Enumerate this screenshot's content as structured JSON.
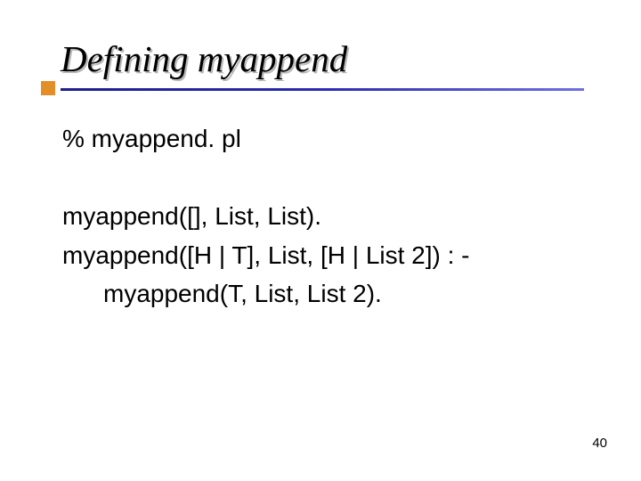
{
  "slide": {
    "title": "Defining myappend",
    "page_number": "40"
  },
  "body": {
    "l1": "% myappend. pl",
    "l2": "myappend([], List, List).",
    "l3": "myappend([H | T], List, [H | List 2]) : -",
    "l4": "myappend(T, List, List 2)."
  }
}
